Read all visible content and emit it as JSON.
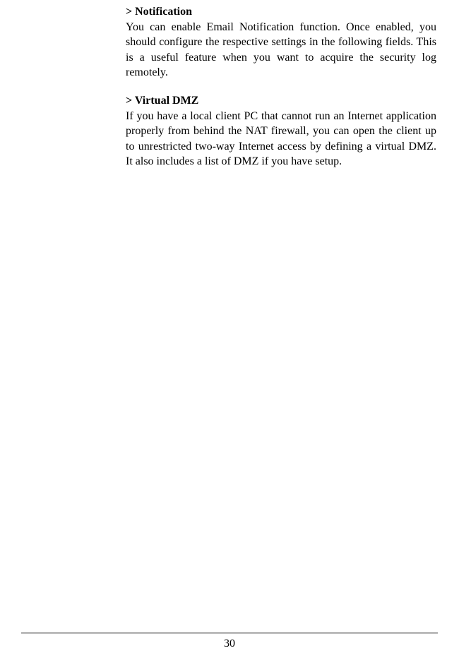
{
  "sections": [
    {
      "heading": "> Notification",
      "body": "You can enable Email Notification function.  Once enabled, you should configure the respective settings in the following fields.  This is a useful feature when you want to acquire the security log remotely."
    },
    {
      "heading": "> Virtual DMZ",
      "body": "If you have a local client PC that cannot run an Internet application properly from behind the NAT firewall, you can open the client up to unrestricted two-way Internet access by defining a virtual DMZ.  It also includes a list of DMZ if you have setup."
    }
  ],
  "page_number": "30"
}
